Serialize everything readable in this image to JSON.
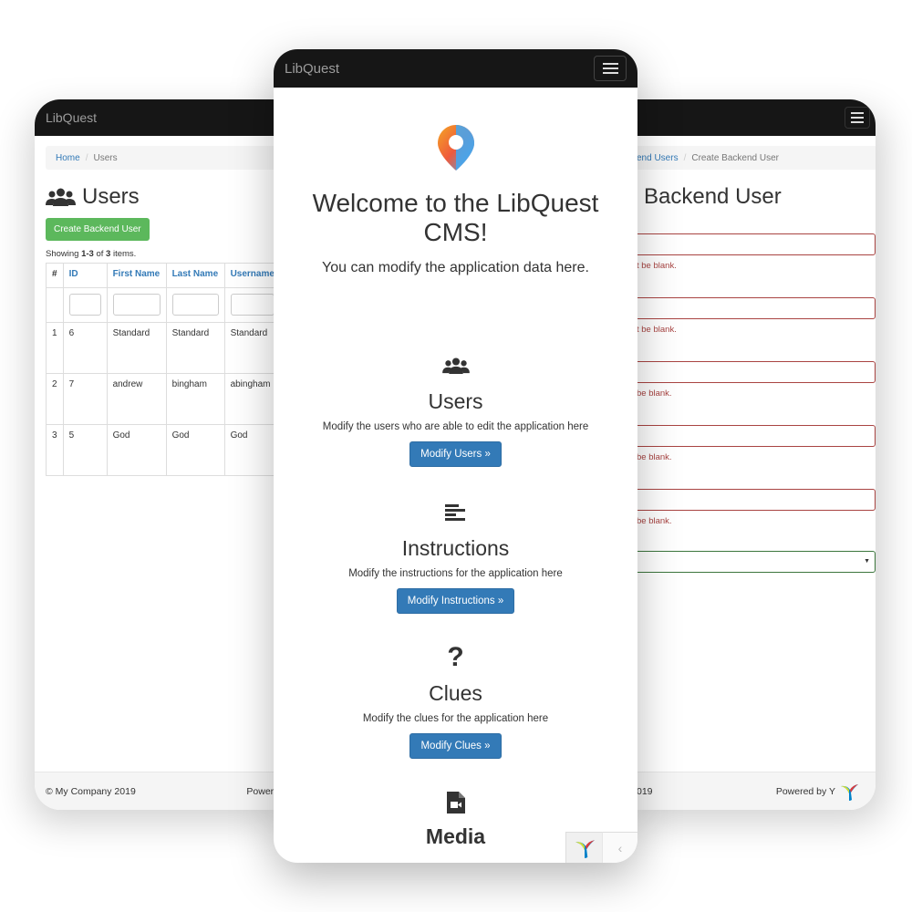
{
  "brand": "LibQuest",
  "left_screen": {
    "breadcrumb": {
      "home": "Home",
      "separator": "/",
      "current": "Users"
    },
    "page_title": "Users",
    "create_button": "Create Backend User",
    "summary": {
      "prefix": "Showing ",
      "range": "1-3",
      "middle": " of ",
      "total": "3",
      "suffix": " items."
    },
    "table": {
      "headers": [
        "#",
        "ID",
        "First Name",
        "Last Name",
        "Username"
      ],
      "rows": [
        [
          "1",
          "6",
          "Standard",
          "Standard",
          "Standard"
        ],
        [
          "2",
          "7",
          "andrew",
          "bingham",
          "abingham"
        ],
        [
          "3",
          "5",
          "God",
          "God",
          "God"
        ]
      ]
    },
    "footer": {
      "copyright": "© My Company 2019",
      "powered": "Powere"
    }
  },
  "center_screen": {
    "welcome_title": "Welcome to the LibQuest CMS!",
    "lead": "You can modify the application data here.",
    "sections": [
      {
        "icon": "users-icon",
        "title": "Users",
        "text": "Modify the users who are able to edit the application here",
        "button": "Modify Users »"
      },
      {
        "icon": "align-left-icon",
        "title": "Instructions",
        "text": "Modify the instructions for the application here",
        "button": "Modify Instructions »"
      },
      {
        "icon": "question-icon",
        "title": "Clues",
        "text": "Modify the clues for the application here",
        "button": "Modify Clues »"
      },
      {
        "icon": "video-file-icon",
        "title": "Media"
      }
    ],
    "debug_arrow": "‹"
  },
  "right_screen": {
    "breadcrumb": {
      "parent": "end Users",
      "separator": "/",
      "current": "Create Backend User"
    },
    "page_title": "Backend User",
    "errors": [
      "t be blank.",
      "t be blank.",
      "be blank.",
      "be blank.",
      "be blank."
    ],
    "footer": {
      "year": "019",
      "powered": "Powered by Y"
    }
  },
  "colors": {
    "navbar": "#161616",
    "link": "#337ab7",
    "success": "#5cb85c",
    "primary": "#337ab7",
    "error": "#a94442",
    "valid": "#3c763d"
  }
}
